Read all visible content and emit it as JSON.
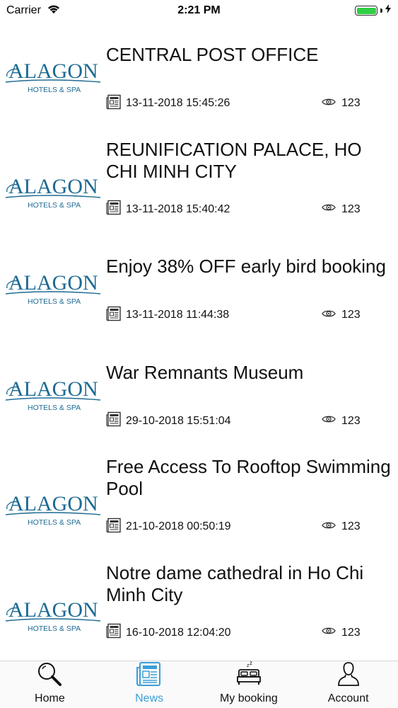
{
  "status_bar": {
    "carrier": "Carrier",
    "time": "2:21 PM",
    "battery_level": 1.0,
    "battery_color": "#2fcf43"
  },
  "logo": {
    "brand": "ALAGON",
    "tagline": "HOTELS & SPA",
    "color": "#1d6a92"
  },
  "news": [
    {
      "title": "CENTRAL POST OFFICE",
      "date": "13-11-2018 15:45:26",
      "views": "123"
    },
    {
      "title": "REUNIFICATION PALACE, HO CHI MINH CITY",
      "date": "13-11-2018 15:40:42",
      "views": "123"
    },
    {
      "title": "Enjoy 38% OFF early bird booking",
      "date": "13-11-2018 11:44:38",
      "views": "123"
    },
    {
      "title": "War Remnants Museum",
      "date": "29-10-2018 15:51:04",
      "views": "123"
    },
    {
      "title": "Free Access To Rooftop Swimming Pool",
      "date": "21-10-2018 00:50:19",
      "views": "123"
    },
    {
      "title": "Notre dame cathedral in Ho Chi Minh City",
      "date": "16-10-2018 12:04:20",
      "views": "123"
    }
  ],
  "tabs": [
    {
      "label": "Home",
      "icon": "search-icon",
      "active": false
    },
    {
      "label": "News",
      "icon": "newspaper-icon",
      "active": true
    },
    {
      "label": "My booking",
      "icon": "bed-icon",
      "active": false
    },
    {
      "label": "Account",
      "icon": "user-icon",
      "active": false
    }
  ],
  "colors": {
    "active_tab": "#3b9fd8",
    "text": "#111111"
  }
}
